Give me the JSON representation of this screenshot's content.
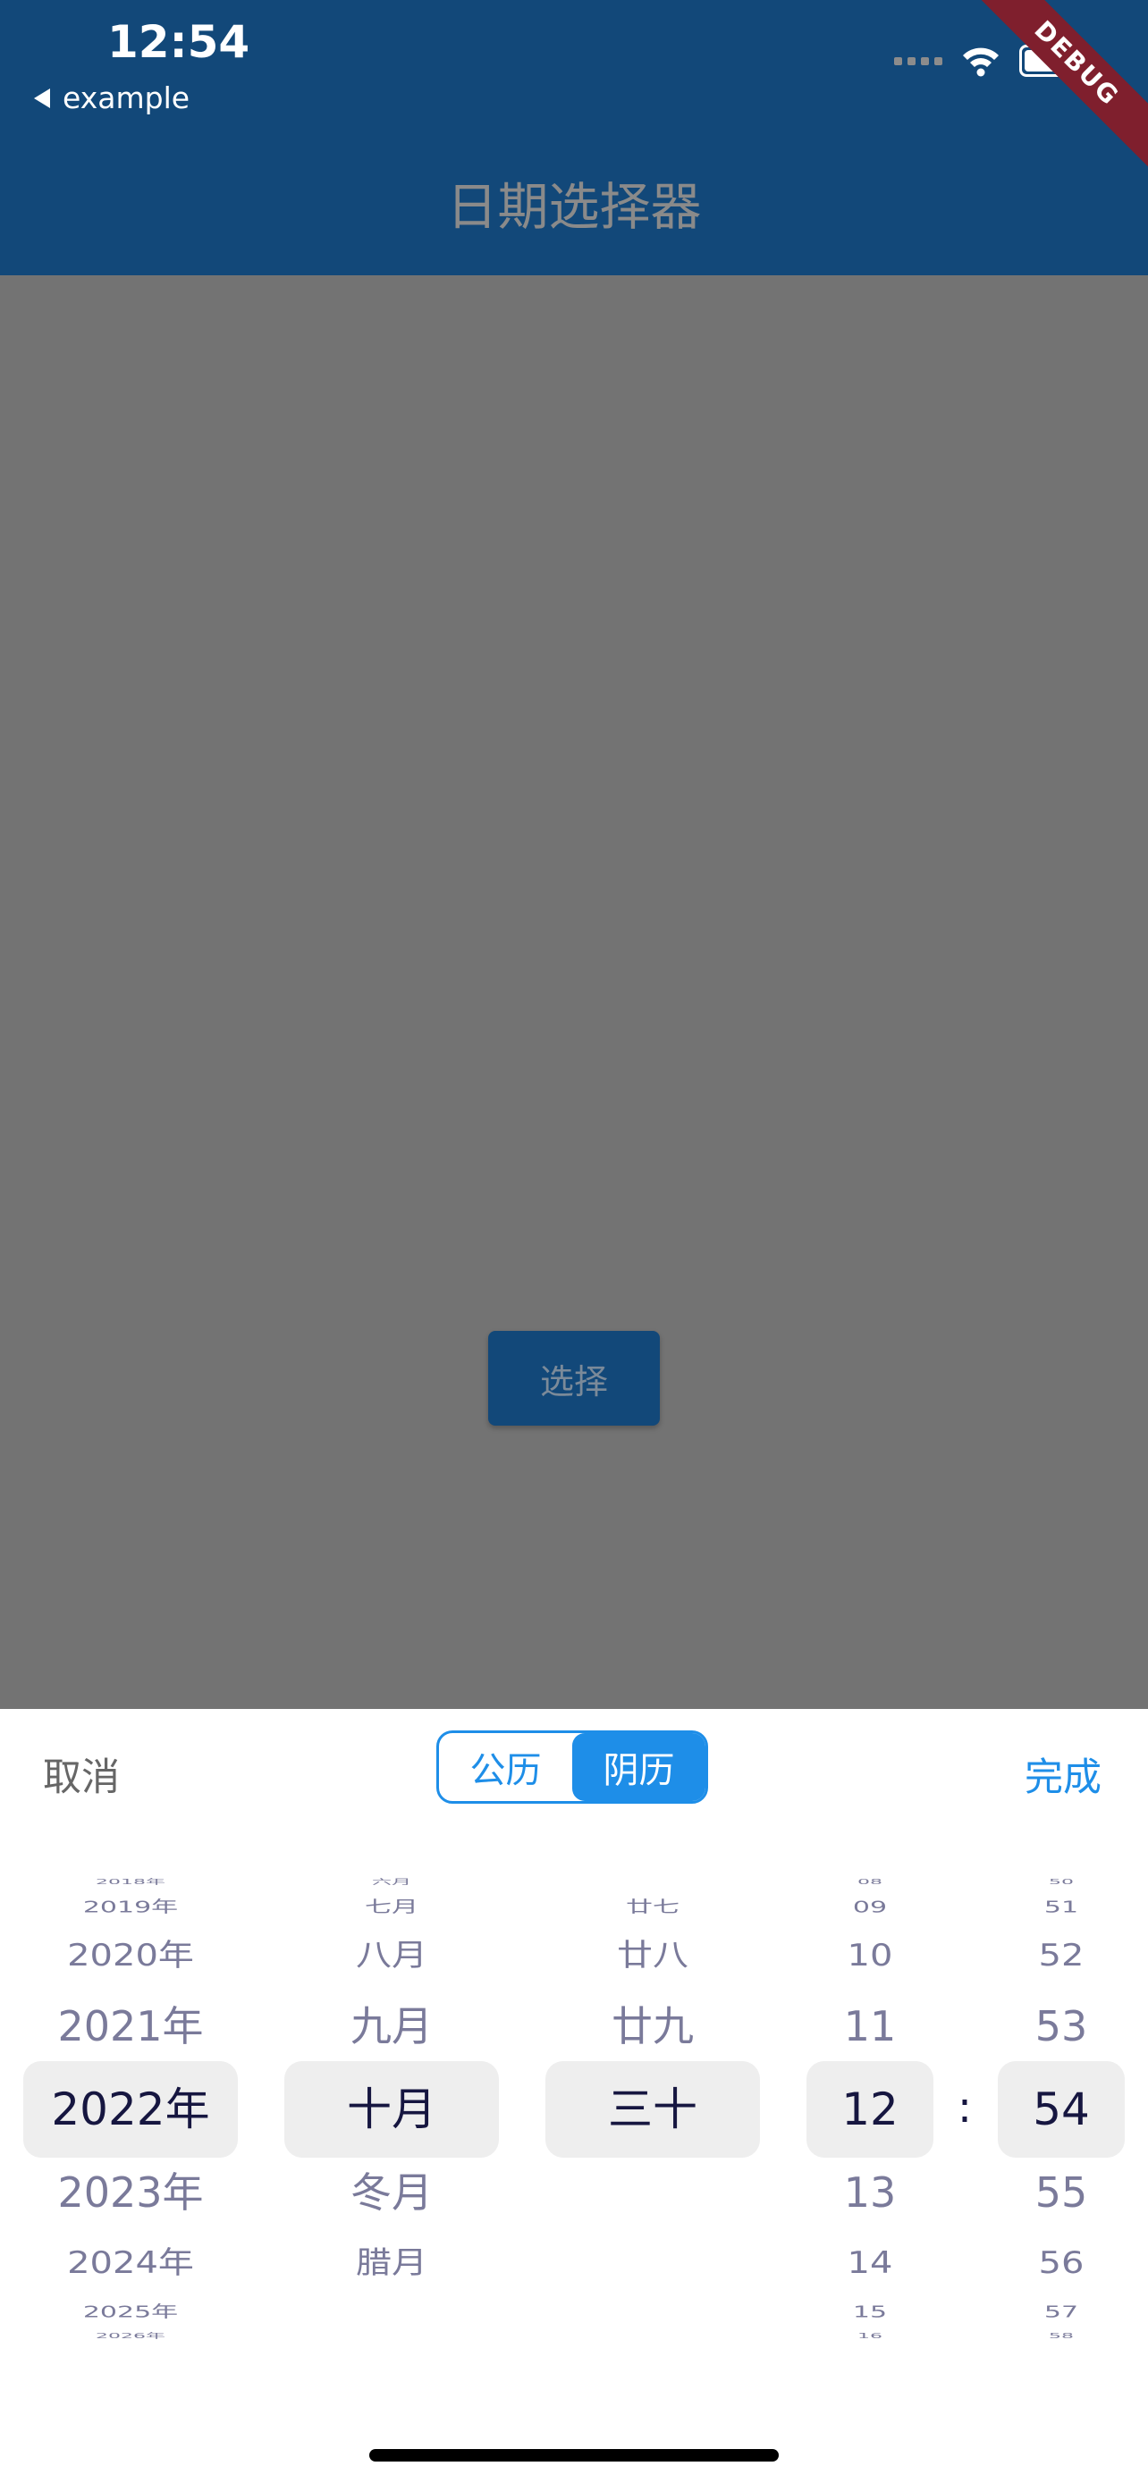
{
  "status_bar": {
    "time": "12:54",
    "back_label": "example"
  },
  "app_bar": {
    "title": "日期选择器",
    "debug_banner": "DEBUG"
  },
  "main": {
    "select_button": "选择"
  },
  "picker": {
    "cancel": "取消",
    "done": "完成",
    "toggle": {
      "solar": "公历",
      "lunar": "阴历",
      "selected": "阴历"
    },
    "colon": ":",
    "columns": {
      "year": [
        "2018年",
        "2019年",
        "2020年",
        "2021年",
        "2022年",
        "2023年",
        "2024年",
        "2025年",
        "2026年"
      ],
      "month": [
        "六月",
        "七月",
        "八月",
        "九月",
        "十月",
        "冬月",
        "腊月"
      ],
      "day": [
        "廿七",
        "廿八",
        "廿九",
        "三十"
      ],
      "hour": [
        "08",
        "09",
        "10",
        "11",
        "12",
        "13",
        "14",
        "15",
        "16"
      ],
      "minute": [
        "50",
        "51",
        "52",
        "53",
        "54",
        "55",
        "56",
        "57",
        "58"
      ]
    },
    "selected": {
      "year": "2022年",
      "month": "十月",
      "day": "三十",
      "hour": "12",
      "minute": "54"
    }
  },
  "colors": {
    "app_bar": "#124879",
    "accent": "#1e8ee8",
    "debug": "#7f1f2d"
  },
  "icons": [
    "back-chevron-icon",
    "signal-dots-icon",
    "wifi-icon",
    "battery-icon"
  ]
}
